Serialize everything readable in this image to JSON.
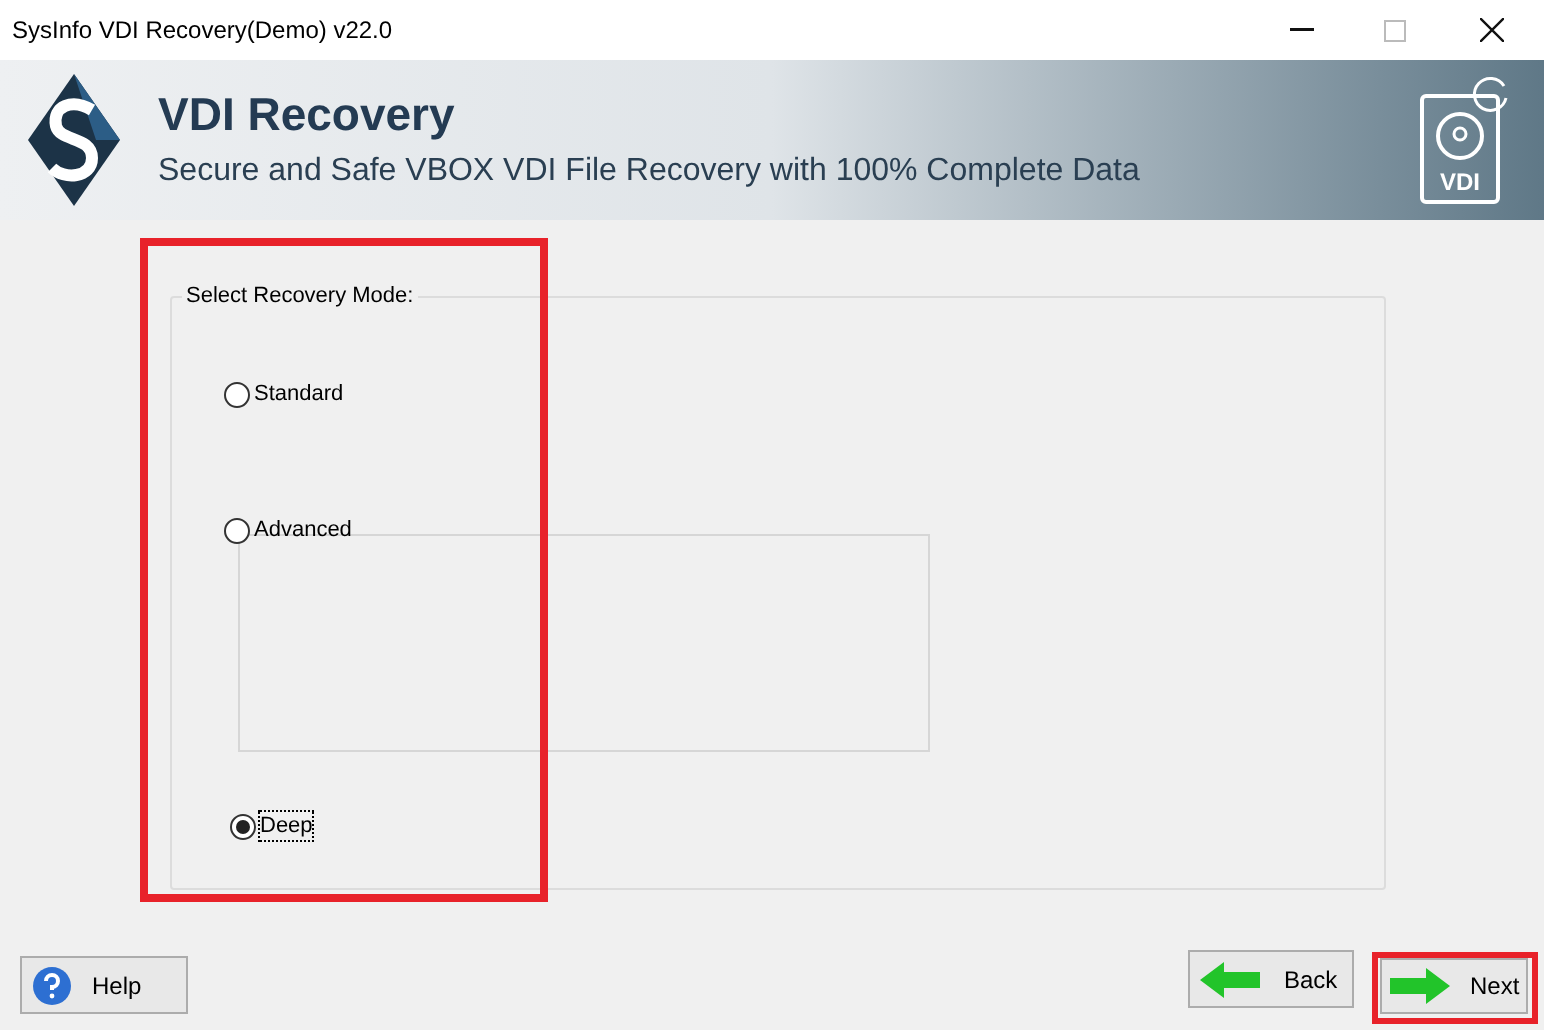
{
  "window": {
    "title": "SysInfo VDI Recovery(Demo) v22.0"
  },
  "header": {
    "title": "VDI Recovery",
    "subtitle": "Secure and Safe VBOX VDI File Recovery with 100% Complete Data",
    "badge": "VDI"
  },
  "recovery_mode": {
    "label": "Select Recovery Mode:",
    "options": [
      {
        "label": "Standard",
        "selected": false,
        "focused": false
      },
      {
        "label": "Advanced",
        "selected": false,
        "focused": false
      },
      {
        "label": "Deep",
        "selected": true,
        "focused": true
      }
    ]
  },
  "buttons": {
    "help": "Help",
    "back": "Back",
    "next": "Next"
  }
}
